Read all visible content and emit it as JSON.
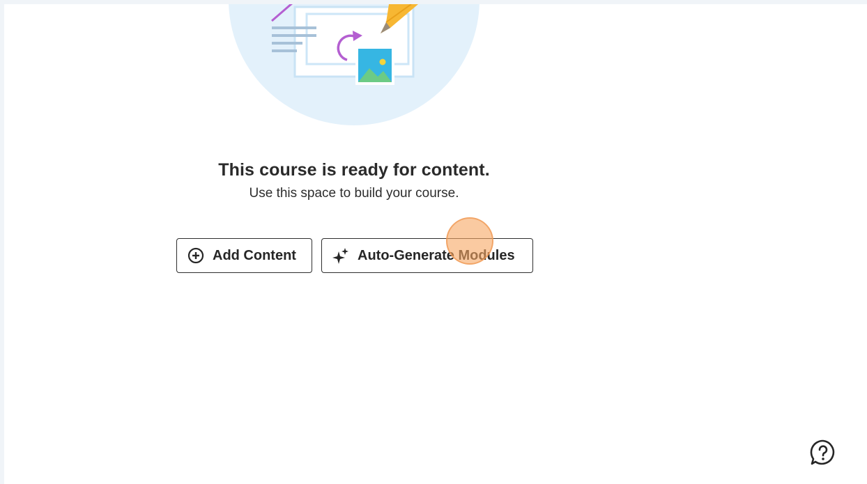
{
  "empty_state": {
    "title": "This course is ready for content.",
    "subtitle": "Use this space to build your course."
  },
  "actions": {
    "add_content_label": "Add Content",
    "add_content_icon": "plus-circle-icon",
    "auto_generate_label": "Auto-Generate Modules",
    "auto_generate_icon": "sparkle-icon"
  },
  "help": {
    "icon": "question-chat-icon"
  },
  "colors": {
    "illustration_bg": "#e3f1fb",
    "cursor_highlight": "#f6a662",
    "text": "#2a2a2a",
    "border": "#2d2d2d"
  }
}
